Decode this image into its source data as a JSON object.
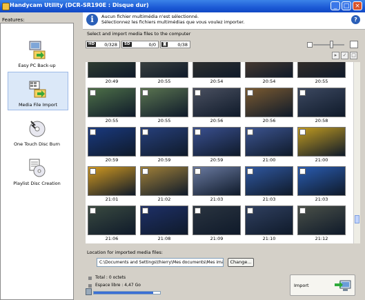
{
  "window": {
    "title": "Handycam Utility (DCR-SR190E : Disque dur)",
    "controls": {
      "minimize": "_",
      "maximize": "□",
      "close": "×"
    }
  },
  "sidebar": {
    "header": "Features:",
    "items": [
      {
        "label": "Easy PC Back-up",
        "icon": "backup-icon"
      },
      {
        "label": "Media File Import",
        "icon": "media-import-icon",
        "active": true
      },
      {
        "label": "One Touch Disc Burn",
        "icon": "disc-burn-icon"
      },
      {
        "label": "Playlist Disc Creation",
        "icon": "playlist-disc-icon"
      }
    ]
  },
  "info": {
    "line1": "Aucun fichier multimédia n'est sélectionné.",
    "line2": "Sélectionnez les fichiers multimédias que vous voulez importer.",
    "help": "?"
  },
  "main": {
    "select_label": "Select and import media files to the computer",
    "filters": [
      {
        "tag": "HD",
        "count": "0/328"
      },
      {
        "tag": "SD",
        "count": "0/0"
      },
      {
        "tag": "◙",
        "count": "0/38"
      }
    ],
    "zoom_level": 0.52
  },
  "thumbnails": {
    "times": [
      [
        "20:49",
        "20:55",
        "20:54",
        "20:54",
        "20:55"
      ],
      [
        "20:55",
        "20:55",
        "20:56",
        "20:56",
        "20:58"
      ],
      [
        "20:59",
        "20:59",
        "20:59",
        "21:00",
        "21:00"
      ],
      [
        "21:01",
        "21:02",
        "21:03",
        "21:03",
        "21:03"
      ],
      [
        "21:06",
        "21:08",
        "21:09",
        "21:10",
        "21:12"
      ]
    ],
    "colors": [
      [
        "#3c4a33",
        "#4a4e46",
        "#3a3830",
        "#5a4430",
        "#403428"
      ],
      [
        "#4e7048",
        "#5a7450",
        "#4a5060",
        "#7a5a30",
        "#3c4860"
      ],
      [
        "#1a3a80",
        "#27407c",
        "#3a5090",
        "#3c5490",
        "#c09a20"
      ],
      [
        "#d09820",
        "#a08038",
        "#6a7aa0",
        "#3058a0",
        "#2a5cb0"
      ],
      [
        "#3a4a40",
        "#1e3068",
        "#2a3440",
        "#304060",
        "#4a5048"
      ]
    ]
  },
  "footer": {
    "location_label": "Location for imported media files:",
    "location_path": "C:\\Documents and Settings\\thierry\\Mes documents\\Mes images\\23-1",
    "change_label": "Change...",
    "total_label": "Total : 0 octets",
    "free_label": "Espace libre : 4,47 Go",
    "disk_used": 0.9,
    "import_label": "Import"
  }
}
